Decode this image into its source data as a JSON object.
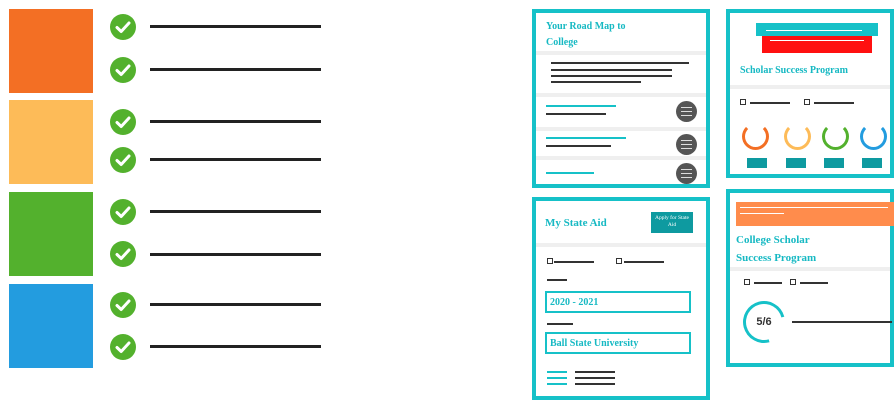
{
  "colors": {
    "orange": "#f36f24",
    "yellow": "#fdbb58",
    "green": "#53b12d",
    "blue": "#239cdf",
    "check": "#53b12d",
    "teal": "#16c1c8",
    "red": "#ff1010",
    "peach": "#ff8c4c"
  },
  "checklist": {
    "swatches": [
      "orange",
      "yellow",
      "green",
      "blue"
    ],
    "items_per_swatch": 2,
    "icon": "check-circle-icon"
  },
  "roadmap": {
    "title": "Your Road Map to College",
    "items_icon": "menu-icon"
  },
  "state_aid": {
    "title": "My State Aid",
    "apply_button": "Apply for State Aid",
    "year": "2020 - 2021",
    "school": "Ball State University"
  },
  "scholar": {
    "title": "Scholar Success Program",
    "rings": [
      "#f36f24",
      "#fdbb58",
      "#53b12d",
      "#239cdf"
    ]
  },
  "college_scholar": {
    "title_line1": "College Scholar",
    "title_line2": "Success Program",
    "progress": "5/6"
  }
}
